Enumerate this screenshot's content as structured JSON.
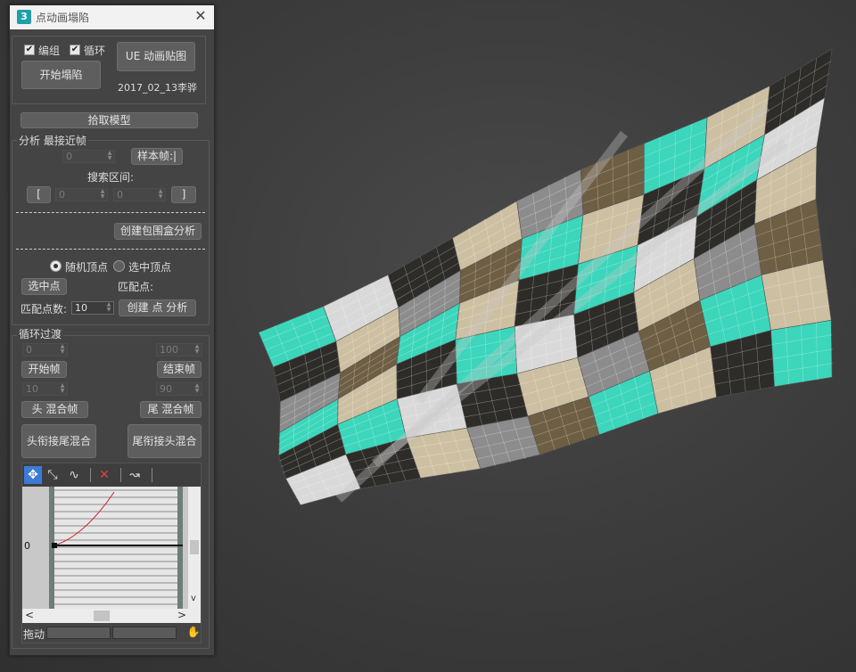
{
  "window": {
    "title": "点动画塌陷",
    "icon_text": "3"
  },
  "top_group": {
    "checkbox_group_label": "编组",
    "checkbox_group_checked": true,
    "checkbox_loop_label": "循环",
    "checkbox_loop_checked": true,
    "start_collapse_label": "开始塌陷",
    "ue_anim_label": "UE 动画贴图",
    "date_author": "2017_02_13李骅"
  },
  "pick_model_label": "拾取模型",
  "analysis": {
    "group_label": "分析 最接近帧",
    "frame_value": "0",
    "sample_frame_label": "样本帧:|",
    "search_range_label": "搜索区间:",
    "bracket_left": "[",
    "bracket_right": "]",
    "range_start": "0",
    "range_end": "0",
    "create_bbox_label": "创建包围盒分析",
    "radio_random_label": "随机顶点",
    "radio_random_selected": true,
    "radio_selected_label": "选中顶点",
    "select_point_label": "选中点",
    "match_point_label": "匹配点:",
    "match_count_label": "匹配点数:",
    "match_count_value": "10",
    "create_point_analysis_label": "创建 点 分析"
  },
  "loop": {
    "group_label": "循环过渡",
    "start_value": "0",
    "end_value": "100",
    "start_frame_label": "开始帧",
    "end_frame_label": "结束帧",
    "head_value": "10",
    "tail_value": "90",
    "head_blend_label": "头 混合帧",
    "tail_blend_label": "尾 混合帧",
    "head_to_tail_label": "头衔接尾混合",
    "tail_to_head_label": "尾衔接头混合"
  },
  "curve_editor": {
    "zero_label": "0",
    "drag_label": "拖动",
    "scroll_left": "<",
    "scroll_right": ">",
    "scroll_down": "v"
  },
  "colors": {
    "teal": "#3cd6bc",
    "beige": "#cdbfa2",
    "dark": "#2e2c28",
    "gray": "#8c8c8c",
    "brown": "#6e5e44",
    "light": "#d9d9d9",
    "curve_red": "#cc2222"
  },
  "icons": [
    "move-icon",
    "scale-icon",
    "add-key-icon",
    "delete-icon",
    "curve-icon",
    "hand-icon"
  ]
}
